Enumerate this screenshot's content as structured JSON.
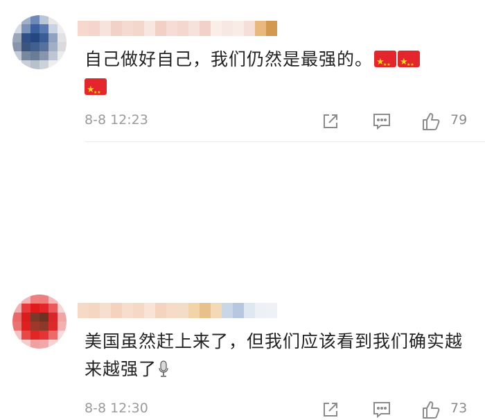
{
  "comments": [
    {
      "text": "自己做好自己，我们仍然是最强的。",
      "trailing_emoji": [
        "china-flag",
        "china-flag",
        "china-flag"
      ],
      "time": "8-8 12:23",
      "likes": "79",
      "avatar_colors": [
        "#f2f2f2",
        "#9fb1c9",
        "#6d89b8",
        "#b9c6d8",
        "#e8e8e8",
        "#f0f0f0",
        "#d5dbe4",
        "#7a92b8",
        "#3c5fa0",
        "#5a79b0",
        "#c9d2e0",
        "#eeeeee",
        "#9aa7ba",
        "#2f4f86",
        "#25477f",
        "#3a5d98",
        "#8fa2c0",
        "#e2e2e2",
        "#8796ad",
        "#3a567f",
        "#40608f",
        "#56719b",
        "#a1afc4",
        "#dadada",
        "#c4cbd6",
        "#77889f",
        "#6a7d96",
        "#8796aa",
        "#bdc6d2",
        "#ececec",
        "#f3f3f3",
        "#c9cfd8",
        "#b8c0cb",
        "#cdd2d9",
        "#eeeeee",
        "#f5f5f5"
      ],
      "name_colors": [
        "#f6d8cf",
        "#f4d4cc",
        "#f7e2dc",
        "#f2d1c9",
        "#f5dad2",
        "#f3d6cc",
        "#f8e6e0",
        "#f3d0c6",
        "#f6dcd5",
        "#f4d7ce",
        "#f7e1db",
        "#f2d2c8",
        "#fbeee9",
        "#f8e8e3",
        "#f9ebe6",
        "#f6dfd8",
        "#e9b87f",
        "#d39a4f"
      ]
    },
    {
      "text": "美国虽然赶上来了，但我们应该看到我们确实越来越强了",
      "trailing_emoji": [
        "microphone"
      ],
      "time": "8-8 12:30",
      "likes": "73",
      "avatar_colors": [
        "#f7e4e4",
        "#f1b6b6",
        "#ee7f7f",
        "#f07d7d",
        "#f4b8b8",
        "#f8e8e8",
        "#f0b0b0",
        "#e83a3a",
        "#e01b1b",
        "#e2262a",
        "#ea5a5a",
        "#f6d4d4",
        "#eb6868",
        "#d91c1c",
        "#7a3a2a",
        "#6b3324",
        "#d8262a",
        "#f1a4a4",
        "#ec7272",
        "#df2020",
        "#a0382a",
        "#8a3a28",
        "#dc2a2a",
        "#f2b0b0",
        "#f4c2c2",
        "#e84848",
        "#e22626",
        "#e43434",
        "#ec6a6a",
        "#f7dada",
        "#faf0f0",
        "#f5cccc",
        "#f0a0a0",
        "#f2a8a8",
        "#f6d2d2",
        "#fbf2f2"
      ],
      "name_colors": [
        "#f6dac8",
        "#f5d6c2",
        "#f7dfcf",
        "#f4d2bd",
        "#f6ddcc",
        "#f5d8c5",
        "#f8e3d5",
        "#f4d3bf",
        "#f6dbc9",
        "#f3dcc8",
        "#f2d4a8",
        "#e8c08a",
        "#f4d9b6",
        "#c9d6e6",
        "#b6c8df",
        "#dfe7f1",
        "#edf1f7",
        "#eef2f7"
      ]
    }
  ],
  "icons": {
    "share": "share-icon",
    "reply": "comment-icon",
    "like": "thumbs-up-icon"
  }
}
